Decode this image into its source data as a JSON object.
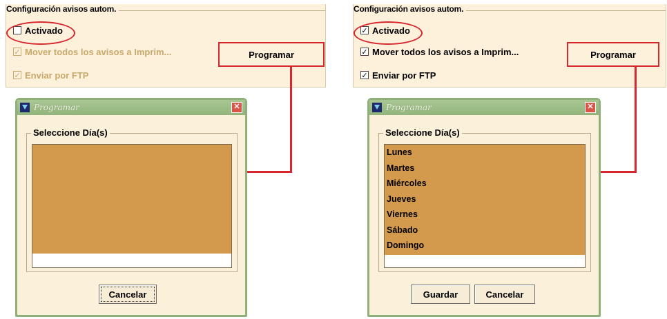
{
  "left": {
    "config": {
      "legend": "Configuración avisos autom.",
      "activado": {
        "label": "Activado",
        "checked": false,
        "mark": ""
      },
      "mover": {
        "label": "Mover todos los avisos a Imprim...",
        "mark": "✓"
      },
      "enviar": {
        "label": "Enviar por FTP",
        "mark": "✓"
      },
      "programar_label": "Programar"
    },
    "dialog": {
      "title": "Programar",
      "close": "✕",
      "group_legend": "Seleccione Día(s)",
      "days": [],
      "cancel_label": "Cancelar"
    }
  },
  "right": {
    "config": {
      "legend": "Configuración avisos autom.",
      "activado": {
        "label": "Activado",
        "checked": true,
        "mark": "✓"
      },
      "mover": {
        "label": "Mover todos los avisos a Imprim...",
        "mark": "✓"
      },
      "enviar": {
        "label": "Enviar por FTP",
        "mark": "✓"
      },
      "programar_label": "Programar"
    },
    "dialog": {
      "title": "Programar",
      "close": "✕",
      "group_legend": "Seleccione Día(s)",
      "days": [
        "Lunes",
        "Martes",
        "Miércoles",
        "Jueves",
        "Viernes",
        "Sábado",
        "Domingo"
      ],
      "save_label": "Guardar",
      "cancel_label": "Cancelar"
    }
  },
  "colors": {
    "highlight": "#d8262d",
    "list_bg": "#d3994d",
    "panel_bg": "#fdf1dc",
    "title_bar": "#93b47c"
  }
}
